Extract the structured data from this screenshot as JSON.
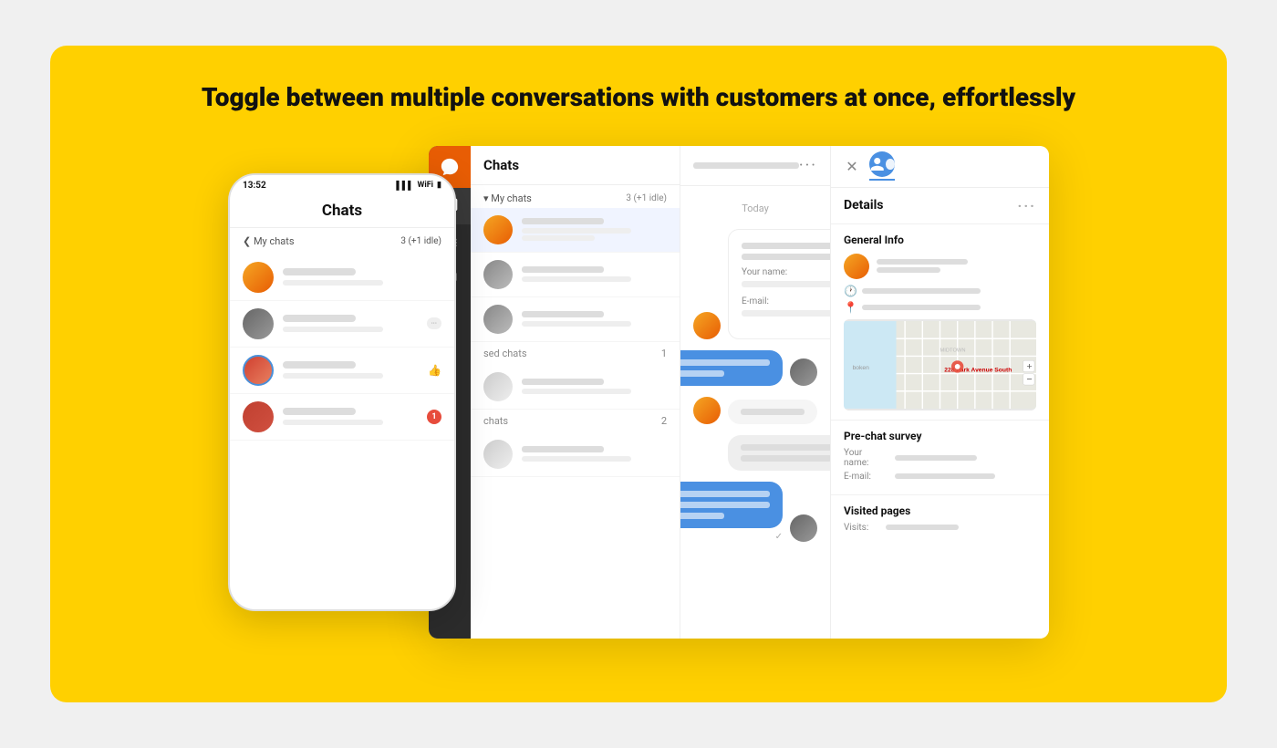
{
  "headline": "Toggle between multiple conversations with customers at once, effortlessly",
  "phone": {
    "time": "13:52",
    "title": "Chats",
    "section_label": "My chats",
    "section_count": "3 (+1 idle)",
    "chats": [
      {
        "type": "female",
        "has_badge": false
      },
      {
        "type": "male",
        "has_badge": "dots"
      },
      {
        "type": "male2",
        "has_badge": "thumb"
      },
      {
        "type": "male3",
        "has_badge": "red",
        "red_count": "1"
      }
    ]
  },
  "desktop": {
    "chats_title": "Chats",
    "my_chats_label": "My chats",
    "my_chats_count": "3 (+1 idle)",
    "supervised_label": "sed chats",
    "supervised_count": "1",
    "other_label": "chats",
    "other_count": "2",
    "header_dots": "···",
    "date_label": "Today"
  },
  "details": {
    "title": "Details",
    "dots": "···",
    "general_info_title": "General Info",
    "pre_chat_title": "Pre-chat survey",
    "your_name_label": "Your name:",
    "email_label": "E-mail:",
    "visited_title": "Visited pages",
    "visits_label": "Visits:"
  },
  "map": {
    "address": "228 Park Avenue South"
  }
}
